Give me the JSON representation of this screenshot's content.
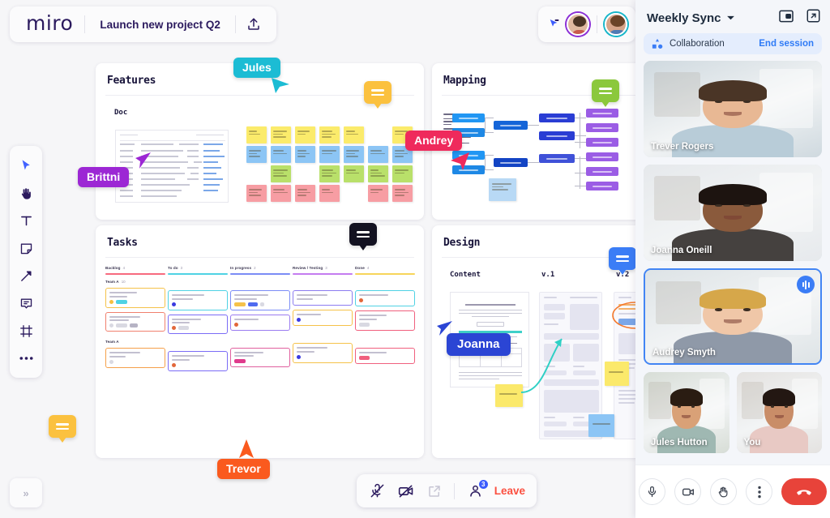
{
  "topbar": {
    "logo": "miro",
    "project_title": "Launch new project Q2",
    "share_icon": "upload-share-icon",
    "cursor_share_icon": "cursor-share-icon"
  },
  "left_toolbar": {
    "tools": [
      {
        "name": "select-cursor-tool",
        "icon": "cursor-icon",
        "selected": true
      },
      {
        "name": "hand-pan-tool",
        "icon": "hand-icon",
        "selected": false
      },
      {
        "name": "text-tool",
        "icon": "text-icon",
        "selected": false
      },
      {
        "name": "sticky-note-tool",
        "icon": "sticky-note-icon",
        "selected": false
      },
      {
        "name": "pen-tool",
        "icon": "pen-icon",
        "selected": false
      },
      {
        "name": "comment-tool",
        "icon": "comment-icon",
        "selected": false
      },
      {
        "name": "frame-tool",
        "icon": "frame-icon",
        "selected": false
      },
      {
        "name": "more-tools",
        "icon": "ellipsis-icon",
        "selected": false
      }
    ],
    "collapse_label": "»"
  },
  "boards": [
    {
      "id": "features",
      "title": "Features",
      "sub": "Doc"
    },
    {
      "id": "mapping",
      "title": "Mapping",
      "sub": ""
    },
    {
      "id": "tasks",
      "title": "Tasks",
      "sub": ""
    },
    {
      "id": "design",
      "title": "Design",
      "sub": ""
    }
  ],
  "design_columns": [
    "Content",
    "v.1",
    "v.2"
  ],
  "kanban": {
    "columns": [
      {
        "title": "Backlog",
        "count": "4",
        "color": "#f76a7e"
      },
      {
        "title": "To do",
        "count": "3",
        "color": "#4fd2e4"
      },
      {
        "title": "In progress",
        "count": "2",
        "color": "#7b8cf6"
      },
      {
        "title": "Review / Testing",
        "count": "3",
        "color": "#c47cf0"
      },
      {
        "title": "Done",
        "count": "4",
        "color": "#f7d55a"
      }
    ],
    "group_label": "Team A",
    "group_count": "10"
  },
  "cursors": [
    {
      "name": "Jules",
      "color": "#1cbcd4"
    },
    {
      "name": "Brittni",
      "color": "#9c27d4"
    },
    {
      "name": "Andrey",
      "color": "#ef2a5c"
    },
    {
      "name": "Joanna",
      "color": "#2b45d4"
    },
    {
      "name": "Trevor",
      "color": "#fa5a1e"
    }
  ],
  "comment_bubbles": [
    {
      "name": "comment-bubble-features",
      "color": "#fbc13f"
    },
    {
      "name": "comment-bubble-mapping",
      "color": "#8bc83c"
    },
    {
      "name": "comment-bubble-tasks",
      "color": "#131221"
    },
    {
      "name": "comment-bubble-design",
      "color": "#3b7df6"
    },
    {
      "name": "comment-bubble-canvas",
      "color": "#fbc13f"
    }
  ],
  "call_toolbar": {
    "mic_icon": "mic-muted-icon",
    "camera_icon": "camera-muted-icon",
    "share_icon": "share-screen-icon",
    "participants_icon": "participants-icon",
    "participants_badge": "3",
    "leave_label": "Leave"
  },
  "panel": {
    "title": "Weekly Sync",
    "caret_icon": "chevron-down-icon",
    "pip_icon": "picture-in-picture-icon",
    "expand_icon": "open-external-icon",
    "collab_icon": "shapes-icon",
    "collab_label": "Collaboration",
    "end_session_label": "End session",
    "participants": [
      {
        "name": "Trever Rogers",
        "speaking": false,
        "active": false
      },
      {
        "name": "Joanna Oneill",
        "speaking": false,
        "active": false
      },
      {
        "name": "Audrey Smyth",
        "speaking": true,
        "active": true
      },
      {
        "name": "Jules Hutton",
        "speaking": false,
        "active": false
      },
      {
        "name": "You",
        "speaking": false,
        "active": false
      }
    ],
    "controls": [
      {
        "name": "mic-button",
        "icon": "mic-icon"
      },
      {
        "name": "camera-button",
        "icon": "camera-icon"
      },
      {
        "name": "raise-hand-button",
        "icon": "hand-raise-icon"
      },
      {
        "name": "more-options-button",
        "icon": "kebab-menu-icon"
      },
      {
        "name": "end-call-button",
        "icon": "phone-hangup-icon"
      }
    ]
  },
  "colors": {
    "accent_blue": "#4262ff",
    "link_blue": "#2f7bf6",
    "danger_red": "#e8433a",
    "leave_red": "#fb4f3f",
    "brand_dark": "#2b1a5e",
    "canvas_bg": "#f6f6f8",
    "panel_bg": "#f4f6fa"
  }
}
